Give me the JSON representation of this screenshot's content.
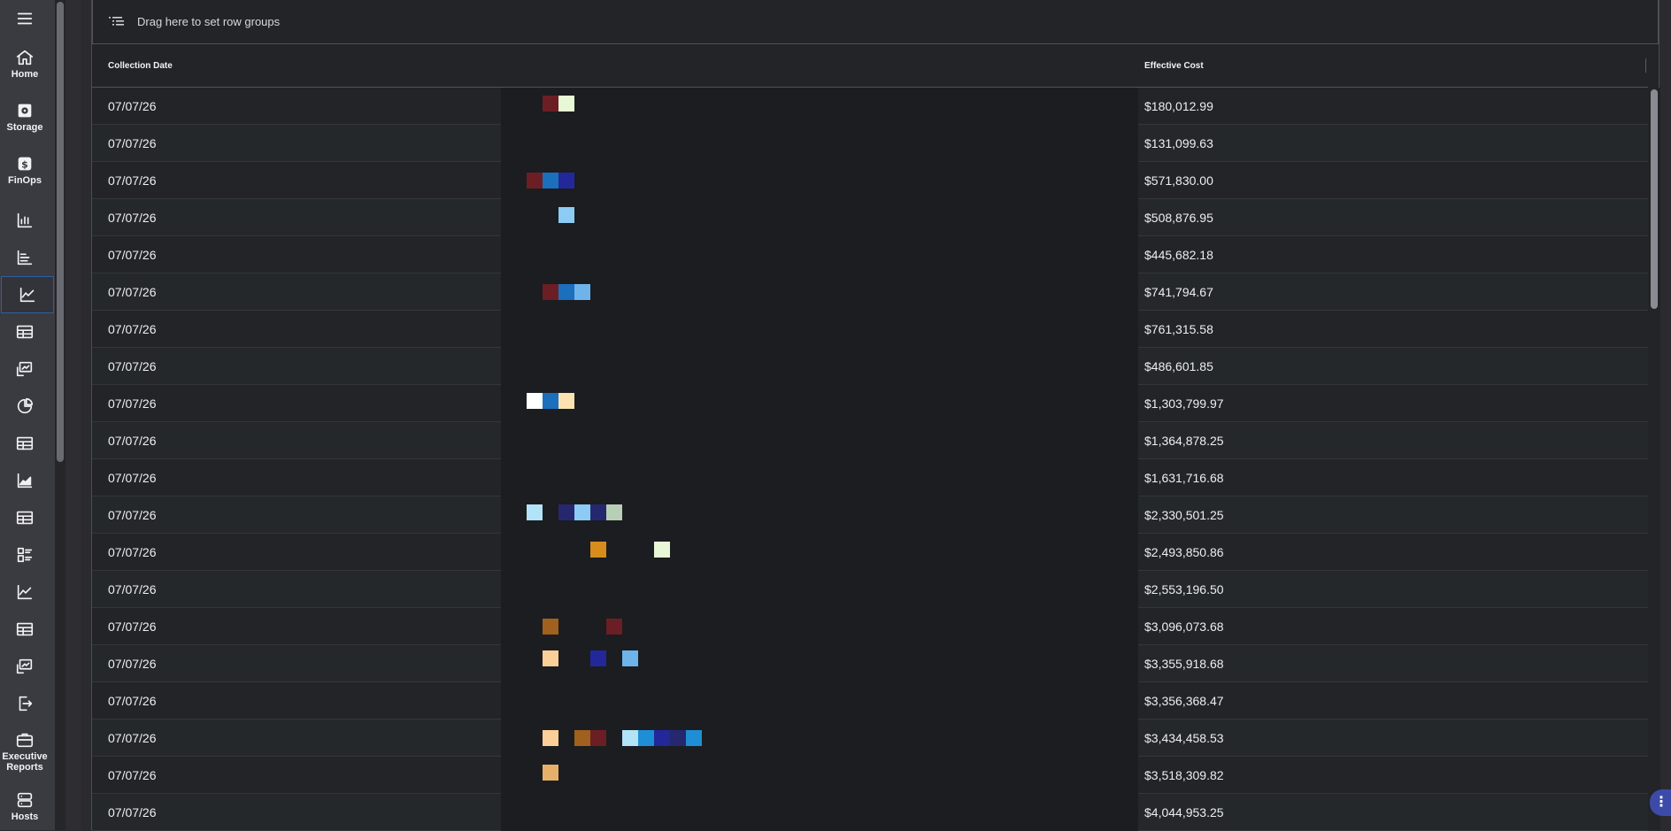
{
  "nav": {
    "items": [
      {
        "name": "menu",
        "label": "",
        "icon": "hamburger-icon"
      },
      {
        "name": "home",
        "label": "Home",
        "icon": "home-icon"
      },
      {
        "name": "storage",
        "label": "Storage",
        "icon": "storage-icon"
      },
      {
        "name": "finops",
        "label": "FinOps",
        "icon": "dollar-icon"
      },
      {
        "name": "bar-chart",
        "label": "",
        "icon": "bar-chart-icon"
      },
      {
        "name": "bar-chart-2",
        "label": "",
        "icon": "bar-chart-left-icon"
      },
      {
        "name": "line-chart",
        "label": "",
        "icon": "line-chart-icon"
      },
      {
        "name": "table",
        "label": "",
        "icon": "table-icon"
      },
      {
        "name": "monitor-chart",
        "label": "",
        "icon": "monitor-chart-icon"
      },
      {
        "name": "pie-chart",
        "label": "",
        "icon": "pie-chart-icon"
      },
      {
        "name": "table-2",
        "label": "",
        "icon": "table-icon"
      },
      {
        "name": "area-chart",
        "label": "",
        "icon": "area-chart-icon"
      },
      {
        "name": "table-3",
        "label": "",
        "icon": "table-icon"
      },
      {
        "name": "dashboard",
        "label": "",
        "icon": "dashboard-icon"
      },
      {
        "name": "line-chart-2",
        "label": "",
        "icon": "line-chart-icon"
      },
      {
        "name": "table-4",
        "label": "",
        "icon": "table-icon"
      },
      {
        "name": "monitor-chart-2",
        "label": "",
        "icon": "monitor-chart-icon"
      },
      {
        "name": "export",
        "label": "",
        "icon": "export-icon"
      },
      {
        "name": "executive-reports",
        "label": "Executive Reports",
        "icon": "briefcase-icon"
      },
      {
        "name": "hosts",
        "label": "Hosts",
        "icon": "server-icon"
      }
    ]
  },
  "grid": {
    "group_bar_text": "Drag here to set row groups",
    "columns": {
      "date": "Collection Date",
      "cost": "Effective Cost"
    },
    "rows": [
      {
        "date": "07/07/26",
        "cost": "$180,012.99"
      },
      {
        "date": "07/07/26",
        "cost": "$131,099.63"
      },
      {
        "date": "07/07/26",
        "cost": "$571,830.00"
      },
      {
        "date": "07/07/26",
        "cost": "$508,876.95"
      },
      {
        "date": "07/07/26",
        "cost": "$445,682.18"
      },
      {
        "date": "07/07/26",
        "cost": "$741,794.67"
      },
      {
        "date": "07/07/26",
        "cost": "$761,315.58"
      },
      {
        "date": "07/07/26",
        "cost": "$486,601.85"
      },
      {
        "date": "07/07/26",
        "cost": "$1,303,799.97"
      },
      {
        "date": "07/07/26",
        "cost": "$1,364,878.25"
      },
      {
        "date": "07/07/26",
        "cost": "$1,631,716.68"
      },
      {
        "date": "07/07/26",
        "cost": "$2,330,501.25"
      },
      {
        "date": "07/07/26",
        "cost": "$2,493,850.86"
      },
      {
        "date": "07/07/26",
        "cost": "$2,553,196.50"
      },
      {
        "date": "07/07/26",
        "cost": "$3,096,073.68"
      },
      {
        "date": "07/07/26",
        "cost": "$3,355,918.68"
      },
      {
        "date": "07/07/26",
        "cost": "$3,356,368.47"
      },
      {
        "date": "07/07/26",
        "cost": "$3,434,458.53"
      },
      {
        "date": "07/07/26",
        "cost": "$3,518,309.82"
      },
      {
        "date": "07/07/26",
        "cost": "$4,044,953.25"
      }
    ]
  },
  "colors": {
    "maroon": "#6b1f24",
    "pale_green": "#e8f7d6",
    "blue": "#1c6fbd",
    "navy": "#22289a",
    "light_blue": "#8ccbf3",
    "sky": "#6eb4ea",
    "white": "#ffffff",
    "cream": "#fbe3b0",
    "ice": "#b3e3f7",
    "dark_navy": "#25286e",
    "sage": "#b7cfb6",
    "orange": "#d88c1c",
    "brown": "#a0601e",
    "peach": "#fbcf9a",
    "cyan": "#1e8fd4",
    "tan": "#e6b06a"
  }
}
